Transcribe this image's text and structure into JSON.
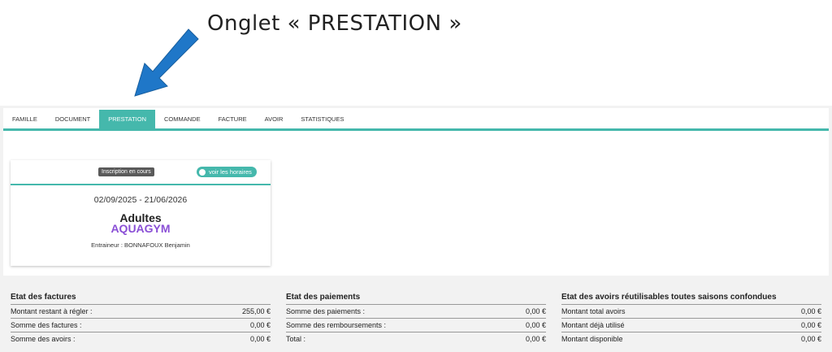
{
  "annotation": {
    "caption": "Onglet « PRESTATION »",
    "arrow_color": "#1f77c8"
  },
  "tabs": [
    {
      "label": "FAMILLE",
      "active": false
    },
    {
      "label": "DOCUMENT",
      "active": false
    },
    {
      "label": "PRESTATION",
      "active": true
    },
    {
      "label": "COMMANDE",
      "active": false
    },
    {
      "label": "FACTURE",
      "active": false
    },
    {
      "label": "AVOIR",
      "active": false
    },
    {
      "label": "STATISTIQUES",
      "active": false
    }
  ],
  "colors": {
    "accent": "#45b8ac",
    "activity": "#8a4fd6",
    "badge_status": "#5a5a5a"
  },
  "card": {
    "status_badge": "Inscription en cours",
    "hours_button": "voir les horaires",
    "dates": "02/09/2025 - 21/06/2026",
    "level": "Adultes",
    "activity": "AQUAGYM",
    "coach": "Entraineur : BONNAFOUX Benjamin"
  },
  "factures": {
    "title": "Etat des factures",
    "rows": [
      {
        "label": "Montant restant à régler :",
        "value": "255,00 €"
      },
      {
        "label": "Somme des factures :",
        "value": "0,00 €"
      },
      {
        "label": "Somme des avoirs :",
        "value": "0,00 €"
      }
    ]
  },
  "paiements": {
    "title": "Etat des paiements",
    "rows": [
      {
        "label": "Somme des paiements :",
        "value": "0,00 €"
      },
      {
        "label": "Somme des remboursements :",
        "value": "0,00 €"
      },
      {
        "label": "Total :",
        "value": "0,00 €"
      }
    ]
  },
  "avoirs": {
    "title": "Etat des avoirs réutilisables toutes saisons confondues",
    "rows": [
      {
        "label": "Montant total avoirs",
        "value": "0,00 €"
      },
      {
        "label": "Montant déjà utilisé",
        "value": "0,00 €"
      },
      {
        "label": "Montant disponible",
        "value": "0,00 €"
      }
    ]
  }
}
